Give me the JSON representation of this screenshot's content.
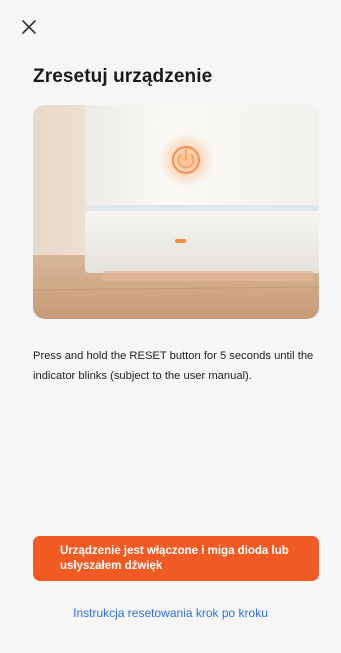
{
  "header": {
    "close_icon": "close-icon",
    "title": "Zresetuj urządzenie"
  },
  "hero": {
    "image_subject": "white smart device with orange power indicator"
  },
  "instructions": {
    "text": "Press and hold the RESET button for 5 seconds until the indicator blinks (subject to the user manual)."
  },
  "actions": {
    "confirm_label": "Urządzenie jest włączone i miga dioda lub usłyszałem dźwięk",
    "guide_link": "Instrukcja resetowania krok po kroku"
  },
  "colors": {
    "accent": "#f25a24",
    "link": "#2f6fe0",
    "background": "#f6f6f7"
  }
}
